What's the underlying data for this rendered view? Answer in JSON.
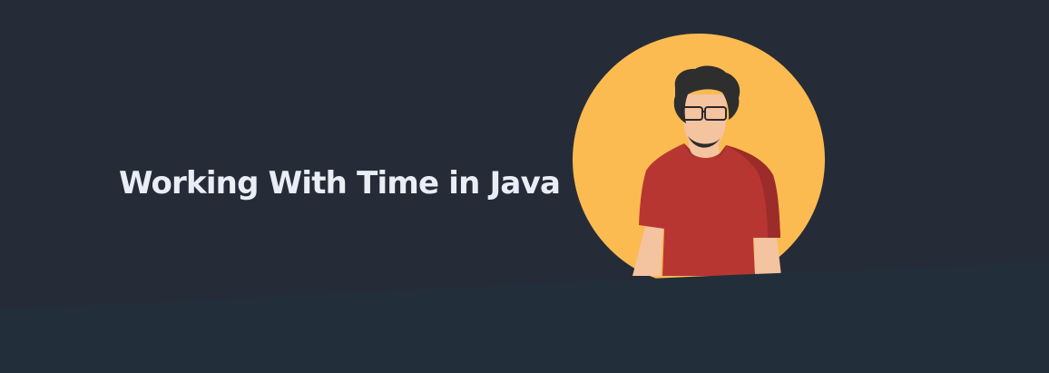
{
  "banner": {
    "title": "Working With Time in Java"
  },
  "illustration": {
    "subject": "person-avatar",
    "colors": {
      "background": "#262c37",
      "wave": "#232e3b",
      "circle": "#fbbb50",
      "shirt": "#b83632",
      "skin": "#f4c3a0",
      "hair": "#2e2e2e"
    }
  }
}
